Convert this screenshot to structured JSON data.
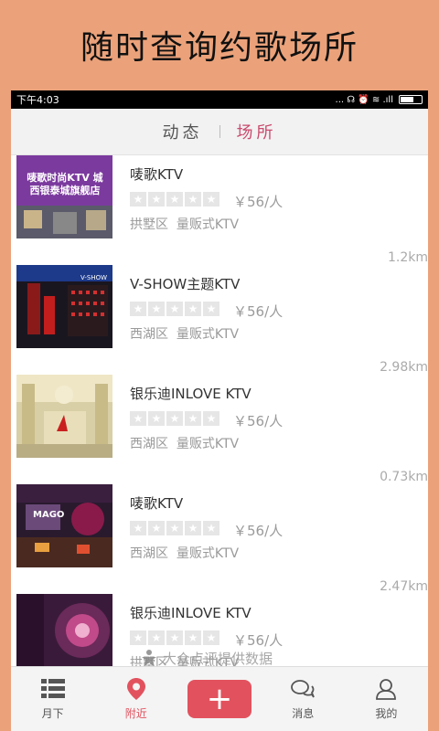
{
  "banner": {
    "title": "随时查询约歌场所"
  },
  "statusbar": {
    "time": "下午4:03",
    "icons": "... ☊ ⏰ ≋ .ıll"
  },
  "tabs": [
    {
      "label": "动态",
      "active": false
    },
    {
      "label": "场所",
      "active": true
    }
  ],
  "venues": [
    {
      "name": "唛歌KTV",
      "price": "￥56/人",
      "district": "拱墅区",
      "type": "量贩式KTV",
      "distance": "1.2km",
      "thumb_text": "唛歌时尚KTV 城西银泰城旗舰店"
    },
    {
      "name": "V-SHOW主题KTV",
      "price": "￥56/人",
      "district": "西湖区",
      "type": "量贩式KTV",
      "distance": "2.98km",
      "thumb_text": "V-SHOW"
    },
    {
      "name": "银乐迪INLOVE KTV",
      "price": "￥56/人",
      "district": "西湖区",
      "type": "量贩式KTV",
      "distance": "0.73km",
      "thumb_text": ""
    },
    {
      "name": "唛歌KTV",
      "price": "￥56/人",
      "district": "西湖区",
      "type": "量贩式KTV",
      "distance": "2.47km",
      "thumb_text": "MAGO"
    },
    {
      "name": "银乐迪INLOVE KTV",
      "price": "￥56/人",
      "district": "拱墅区",
      "type": "量贩式KTV",
      "distance": "",
      "thumb_text": ""
    }
  ],
  "watermark": "大众点评提供数据",
  "bottom_nav": [
    {
      "label": "月下",
      "icon": "list-icon",
      "active": false
    },
    {
      "label": "附近",
      "icon": "location-pin-icon",
      "active": true
    },
    {
      "label": "",
      "icon": "plus-icon",
      "active": false
    },
    {
      "label": "消息",
      "icon": "chat-bubbles-icon",
      "active": false
    },
    {
      "label": "我的",
      "icon": "person-icon",
      "active": false
    }
  ],
  "colors": {
    "accent": "#e2525e",
    "tab_active": "#c94b6e",
    "background": "#eba27a"
  }
}
